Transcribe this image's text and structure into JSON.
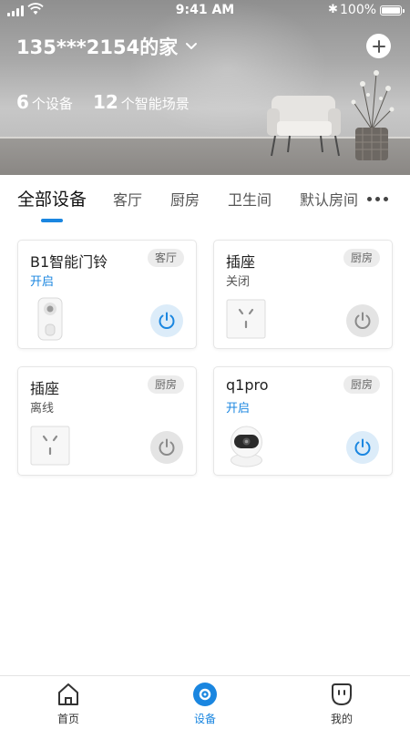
{
  "status_bar": {
    "time": "9:41 AM",
    "battery": "100%",
    "bluetooth_icon": "bluetooth-icon"
  },
  "header": {
    "home_name": "135***2154的家",
    "stats": [
      {
        "num": "6",
        "label": "个设备"
      },
      {
        "num": "12",
        "label": "个智能场景"
      }
    ]
  },
  "tabs": [
    {
      "label": "全部设备",
      "active": true
    },
    {
      "label": "客厅"
    },
    {
      "label": "厨房"
    },
    {
      "label": "卫生间"
    },
    {
      "label": "默认房间"
    }
  ],
  "devices": [
    {
      "name": "B1智能门铃",
      "state": "开启",
      "room": "客厅",
      "power": "on",
      "icon": "doorbell-icon"
    },
    {
      "name": "插座",
      "state": "关闭",
      "room": "厨房",
      "power": "off",
      "icon": "socket-icon"
    },
    {
      "name": "插座",
      "state": "离线",
      "room": "厨房",
      "power": "off",
      "icon": "socket-icon"
    },
    {
      "name": "q1pro",
      "state": "开启",
      "room": "厨房",
      "power": "on",
      "icon": "camera-icon"
    }
  ],
  "bottom_nav": [
    {
      "label": "首页",
      "icon": "home-icon"
    },
    {
      "label": "设备",
      "icon": "device-icon",
      "active": true
    },
    {
      "label": "我的",
      "icon": "profile-icon"
    }
  ],
  "colors": {
    "accent": "#1a86e0",
    "power_on_bg": "#dcecf9",
    "power_off_bg": "#e4e4e4"
  }
}
